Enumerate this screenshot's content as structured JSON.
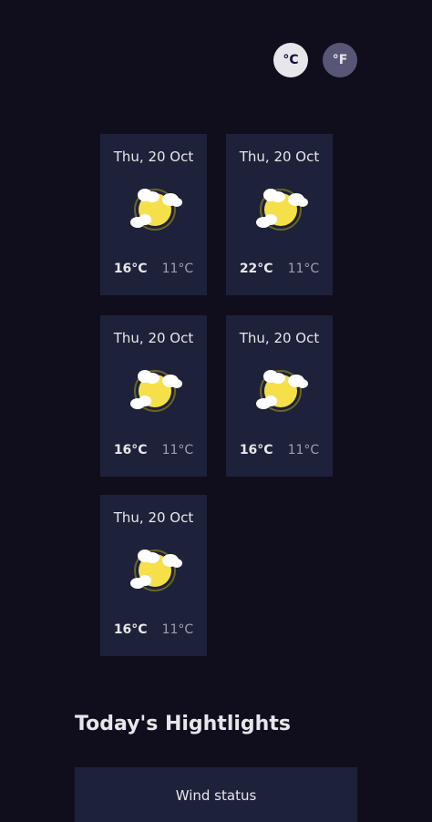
{
  "units": {
    "celsius": "°C",
    "fahrenheit": "°F"
  },
  "forecast": [
    {
      "date": "Thu, 20 Oct",
      "max": "16°C",
      "min": "11°C",
      "icon": "sun-cloud-icon"
    },
    {
      "date": "Thu, 20 Oct",
      "max": "22°C",
      "min": "11°C",
      "icon": "sun-cloud-icon"
    },
    {
      "date": "Thu, 20 Oct",
      "max": "16°C",
      "min": "11°C",
      "icon": "sun-cloud-icon"
    },
    {
      "date": "Thu, 20 Oct",
      "max": "16°C",
      "min": "11°C",
      "icon": "sun-cloud-icon"
    },
    {
      "date": "Thu, 20 Oct",
      "max": "16°C",
      "min": "11°C",
      "icon": "sun-cloud-icon"
    }
  ],
  "highlights": {
    "title": "Today's Hightlights",
    "wind_status_label": "Wind status"
  },
  "colors": {
    "background": "#100e1d",
    "card": "#1e213a",
    "active_unit": "#e7e7eb",
    "inactive_unit": "#585676",
    "sun": "#f5e04a"
  }
}
